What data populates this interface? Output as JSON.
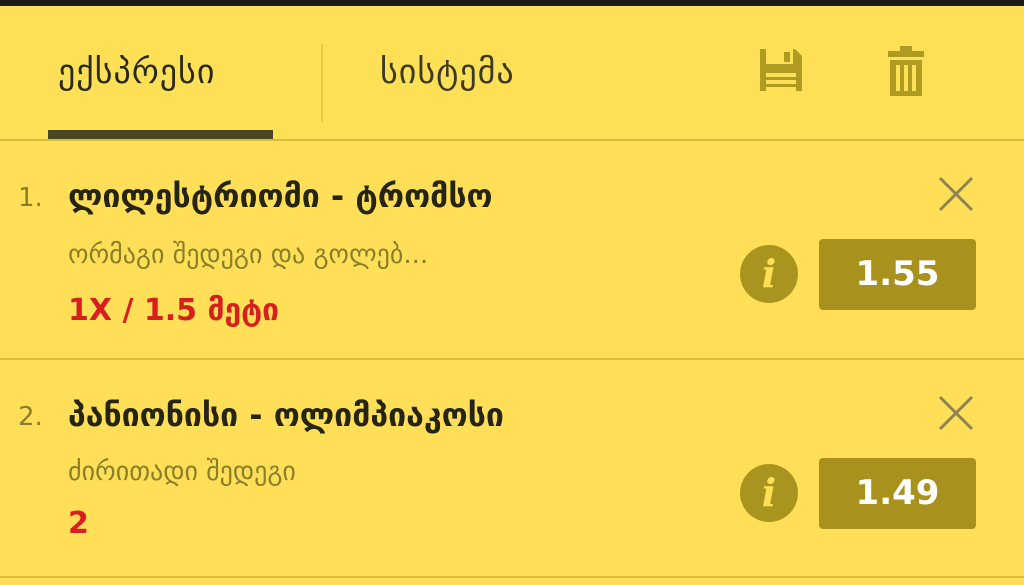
{
  "tabs": {
    "express": "ექსპრესი",
    "system": "სისტემა"
  },
  "icons": {
    "save": "floppy-disk-icon",
    "trash": "trash-icon",
    "close": "close-icon",
    "info": "info-icon"
  },
  "colors": {
    "background": "#ffdf57",
    "accent_dark": "#a8911d",
    "selection_red": "#d62020"
  },
  "bets": [
    {
      "index": "1.",
      "title": "ლილესტრიომი - ტრომსო",
      "market": "ორმაგი შედეგი და გოლებ...",
      "selection": "1X / 1.5 მეტი",
      "info_label": "i",
      "odds": "1.55"
    },
    {
      "index": "2.",
      "title": "პანიონისი - ოლიმპიაკოსი",
      "market": "ძირითადი შედეგი",
      "selection": "2",
      "info_label": "i",
      "odds": "1.49"
    }
  ]
}
